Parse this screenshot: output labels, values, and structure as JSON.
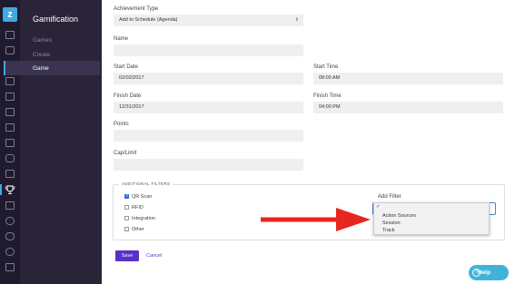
{
  "sidebar_icons": [
    "dashboard-icon",
    "chat-icon",
    "users-icon",
    "card-icon",
    "building-icon",
    "image-icon",
    "list-icon",
    "document-icon",
    "wrench-icon",
    "copy-icon",
    "trophy-icon",
    "grid-icon",
    "toggle-icon",
    "database-icon",
    "gear-icon",
    "export-icon"
  ],
  "submenu": {
    "title": "Gamification",
    "items": [
      "Games",
      "Create",
      "Game"
    ],
    "active": "Game"
  },
  "form": {
    "achievement_type_label": "Achievement Type",
    "achievement_type_value": "Add to Schedule (Agenda)",
    "name_label": "Name",
    "name_value": "",
    "start_date_label": "Start Date",
    "start_date_value": "02/02/2017",
    "start_time_label": "Start Time",
    "start_time_value": "08:00 AM",
    "finish_date_label": "Finish Date",
    "finish_date_value": "12/31/2017",
    "finish_time_label": "Finish Time",
    "finish_time_value": "04:00 PM",
    "points_label": "Points",
    "points_value": "",
    "cap_label": "Cap/Limit",
    "cap_value": ""
  },
  "filters": {
    "legend": "ADDITIONAL FILTERS",
    "checkboxes": [
      {
        "label": "QR Scan",
        "checked": true
      },
      {
        "label": "RFID",
        "checked": false
      },
      {
        "label": "Integration",
        "checked": false
      },
      {
        "label": "Other",
        "checked": false
      }
    ],
    "add_filter_label": "Add Filter",
    "dropdown_options": [
      "Action Sources",
      "Session",
      "Track"
    ]
  },
  "actions": {
    "save": "Save",
    "cancel": "Cancel"
  },
  "help": {
    "label": "Help"
  },
  "colors": {
    "accent": "#5b2fc8",
    "sidebar": "#1f1a2e",
    "help": "#3fb4d8",
    "arrow": "#e8251f"
  }
}
